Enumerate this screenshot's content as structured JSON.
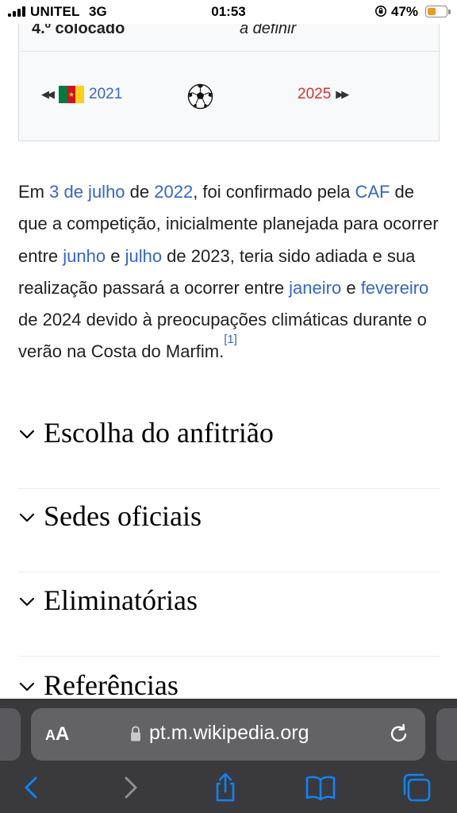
{
  "status_bar": {
    "carrier": "UNITEL",
    "network": "3G",
    "time": "01:53",
    "battery_percent": "47%",
    "battery_level": 0.47,
    "battery_color": "#f09a1a"
  },
  "infobox": {
    "row_label": "4.º colocado",
    "row_value": "a definir",
    "prev_year": "2021",
    "prev_flag": "cameroon-flag",
    "center_icon": "soccer-ball-icon",
    "next_year": "2025",
    "prev_link_color": "#3366cc",
    "next_link_color": "#d33333"
  },
  "paragraph": {
    "t1": "Em ",
    "l1": "3 de julho",
    "t2": " de ",
    "l2": "2022",
    "t3": ", foi confirmado pela ",
    "l3": "CAF",
    "t4": " de que a competição, inicialmente planejada para ocorrer entre ",
    "l4": "junho",
    "t5": " e ",
    "l5": "julho",
    "t6": " de 2023, teria sido adiada e sua realização passará a ocorrer entre ",
    "l6": "janeiro",
    "t7": " e ",
    "l7": "fevereiro",
    "t8": " de 2024 devido à preocupações climáticas durante o verão na Costa do Marfim.",
    "ref": "[1]"
  },
  "sections": [
    {
      "title": "Escolha do anfitrião",
      "icon": "chevron-down-icon"
    },
    {
      "title": "Sedes oficiais",
      "icon": "chevron-down-icon"
    },
    {
      "title": "Eliminatórias",
      "icon": "chevron-down-icon"
    },
    {
      "title": "Referências",
      "icon": "chevron-down-icon"
    }
  ],
  "safari": {
    "aa_small": "A",
    "aa_big": "A",
    "url": "pt.m.wikipedia.org",
    "icons": [
      "lock-icon",
      "reload-icon",
      "back-icon",
      "forward-icon",
      "share-icon",
      "bookmarks-icon",
      "tabs-icon"
    ]
  }
}
